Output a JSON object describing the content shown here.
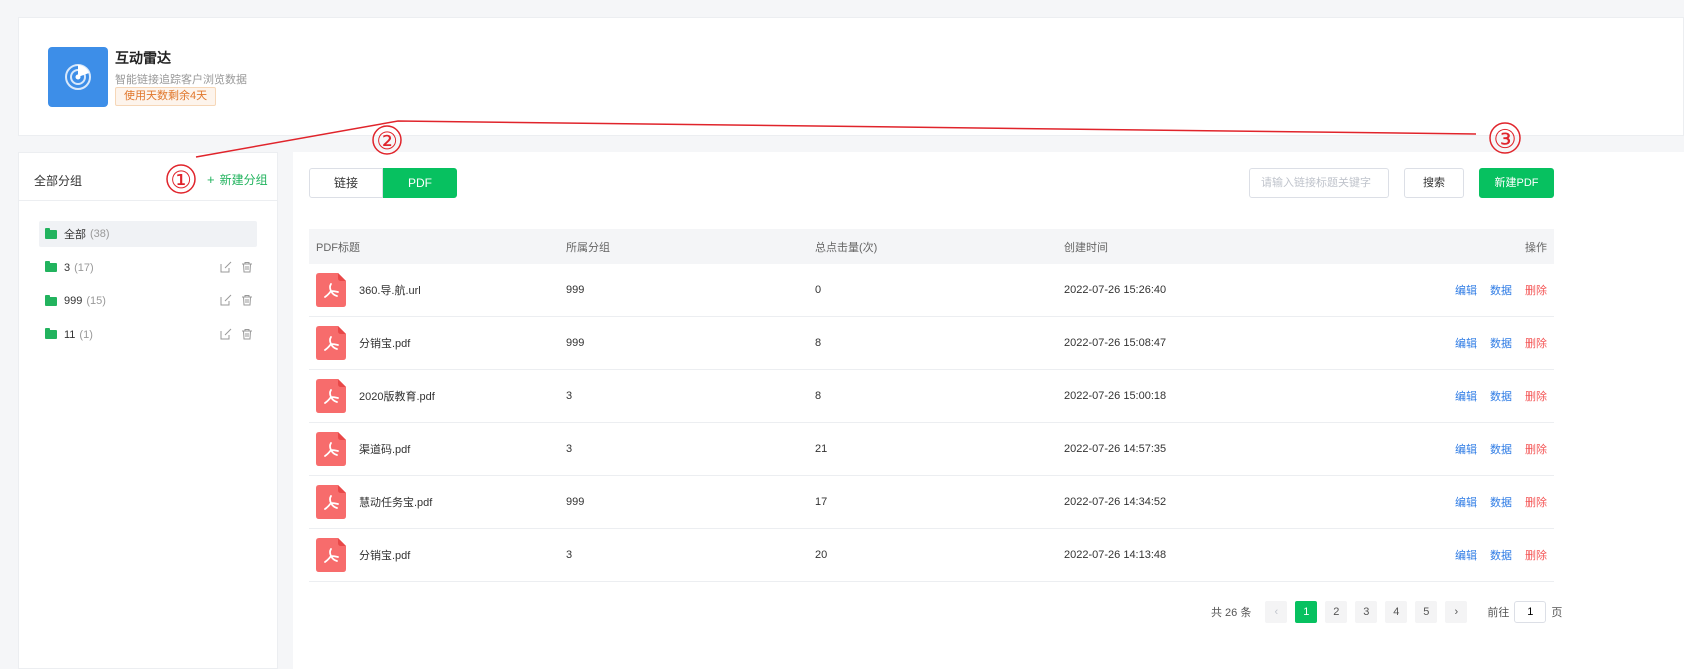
{
  "app": {
    "title": "互动雷达",
    "subtitle": "智能链接追踪客户浏览数据",
    "badge": "使用天数剩余4天",
    "accent": "#3d8ee8"
  },
  "sidebar": {
    "title": "全部分组",
    "new_group_label": "新建分组",
    "groups": [
      {
        "name": "全部",
        "count": "(38)"
      },
      {
        "name": "3",
        "count": "(17)"
      },
      {
        "name": "999",
        "count": "(15)"
      },
      {
        "name": "11",
        "count": "(1)"
      }
    ]
  },
  "toolbar": {
    "tabs": [
      "链接",
      "PDF"
    ],
    "active_tab": "PDF",
    "search_placeholder": "请输入链接标题关键字",
    "search_button": "搜索",
    "new_button": "新建PDF",
    "primary_color": "#07c160"
  },
  "table": {
    "headers": [
      "PDF标题",
      "所属分组",
      "总点击量(次)",
      "创建时间",
      "操作"
    ],
    "rows": [
      {
        "title": "360.导.航.url",
        "group": "999",
        "clicks": "0",
        "created": "2022-07-26 15:26:40"
      },
      {
        "title": "分销宝.pdf",
        "group": "999",
        "clicks": "8",
        "created": "2022-07-26 15:08:47"
      },
      {
        "title": "2020版教育.pdf",
        "group": "3",
        "clicks": "8",
        "created": "2022-07-26 15:00:18"
      },
      {
        "title": "渠道码.pdf",
        "group": "3",
        "clicks": "21",
        "created": "2022-07-26 14:57:35"
      },
      {
        "title": "慧动任务宝.pdf",
        "group": "999",
        "clicks": "17",
        "created": "2022-07-26 14:34:52"
      },
      {
        "title": "分销宝.pdf",
        "group": "3",
        "clicks": "20",
        "created": "2022-07-26 14:13:48"
      }
    ],
    "actions": {
      "edit": "编辑",
      "data": "数据",
      "delete": "删除"
    }
  },
  "pagination": {
    "total": "共 26 条",
    "pages": [
      "1",
      "2",
      "3",
      "4",
      "5"
    ],
    "current": "1",
    "goto_label": "前往",
    "goto_value": "1",
    "page_suffix": "页"
  },
  "annotations": [
    "①",
    "②",
    "③"
  ]
}
